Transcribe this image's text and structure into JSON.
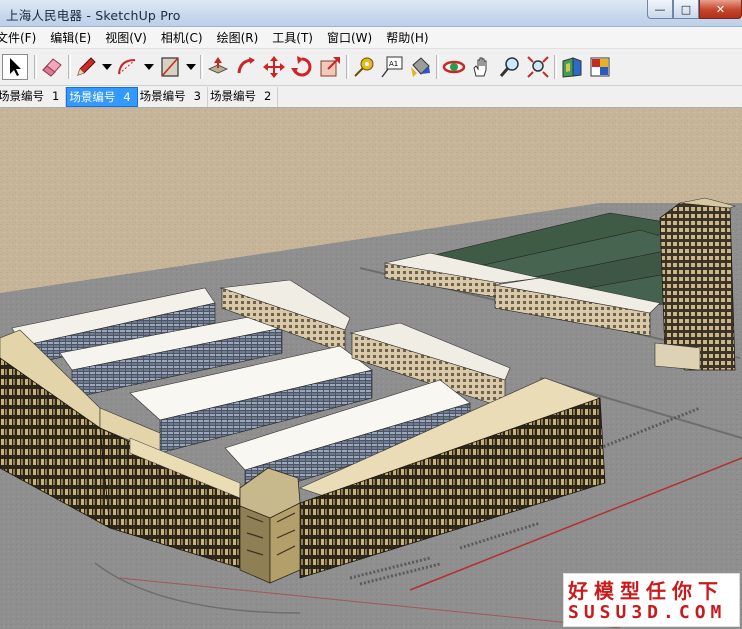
{
  "window": {
    "title": "上海人民电器 - SketchUp Pro",
    "minimize_glyph": "—",
    "maximize_glyph": "□",
    "close_glyph": "✕"
  },
  "menu": {
    "items": [
      {
        "label": "文件(F)"
      },
      {
        "label": "编辑(E)"
      },
      {
        "label": "视图(V)"
      },
      {
        "label": "相机(C)"
      },
      {
        "label": "绘图(R)"
      },
      {
        "label": "工具(T)"
      },
      {
        "label": "窗口(W)"
      },
      {
        "label": "帮助(H)"
      }
    ]
  },
  "toolbar": {
    "tools": [
      "select-arrow-icon",
      "eraser-icon",
      "pencil-icon",
      "arc-icon",
      "rectangle-icon",
      "push-pull-icon",
      "follow-me-icon",
      "move-icon",
      "rotate-icon",
      "scale-icon",
      "tape-measure-icon",
      "text-label-icon",
      "paint-bucket-icon",
      "orbit-icon",
      "pan-icon",
      "zoom-icon",
      "zoom-extents-icon",
      "components-icon",
      "materials-icon"
    ],
    "text_tool_label": "A1"
  },
  "scene_tabs": [
    {
      "label": "场景编号",
      "num": "1",
      "active": false
    },
    {
      "label": "场景编号",
      "num": "4",
      "active": true
    },
    {
      "label": "场景编号",
      "num": "3",
      "active": false
    },
    {
      "label": "场景编号",
      "num": "2",
      "active": false
    }
  ],
  "viewport": {
    "sky_color": "#c9b79c",
    "ground_color": "#8f8f8f",
    "roof_color": "#f2f0ea",
    "facade_color": "#2a2418",
    "green_roof_color": "#3f5a45",
    "accent_color": "#c33b3b"
  },
  "watermark": {
    "line1": "好模型任你下",
    "line2": "SUSU3D.COM"
  }
}
